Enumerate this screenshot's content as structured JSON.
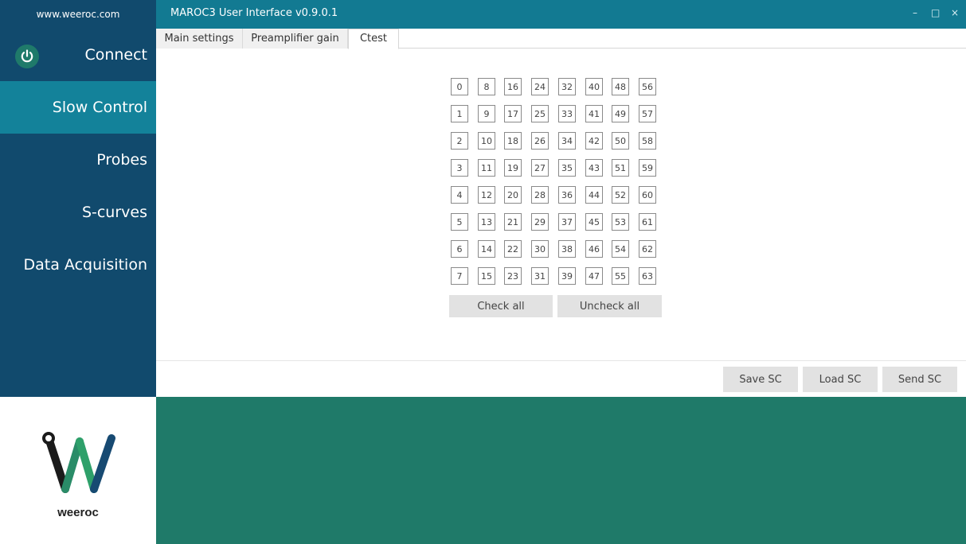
{
  "app": {
    "site": "www.weeroc.com",
    "title": "MAROC3 User Interface v0.9.0.1",
    "brand_name": "weeroc"
  },
  "window_controls": {
    "minimize": "–",
    "maximize": "□",
    "close": "×"
  },
  "nav": {
    "items": [
      {
        "label": "Connect"
      },
      {
        "label": "Slow Control",
        "active": true
      },
      {
        "label": "Probes"
      },
      {
        "label": "S-curves"
      },
      {
        "label": "Data Acquisition"
      }
    ]
  },
  "tabs": [
    {
      "label": "Main settings"
    },
    {
      "label": "Preamplifier gain"
    },
    {
      "label": "Ctest",
      "active": true
    }
  ],
  "ctest": {
    "channels": [
      [
        "0",
        "8",
        "16",
        "24",
        "32",
        "40",
        "48",
        "56"
      ],
      [
        "1",
        "9",
        "17",
        "25",
        "33",
        "41",
        "49",
        "57"
      ],
      [
        "2",
        "10",
        "18",
        "26",
        "34",
        "42",
        "50",
        "58"
      ],
      [
        "3",
        "11",
        "19",
        "27",
        "35",
        "43",
        "51",
        "59"
      ],
      [
        "4",
        "12",
        "20",
        "28",
        "36",
        "44",
        "52",
        "60"
      ],
      [
        "5",
        "13",
        "21",
        "29",
        "37",
        "45",
        "53",
        "61"
      ],
      [
        "6",
        "14",
        "22",
        "30",
        "38",
        "46",
        "54",
        "62"
      ],
      [
        "7",
        "15",
        "23",
        "31",
        "39",
        "47",
        "55",
        "63"
      ]
    ],
    "check_all": "Check all",
    "uncheck_all": "Uncheck all"
  },
  "actions": {
    "save_sc": "Save SC",
    "load_sc": "Load SC",
    "send_sc": "Send SC"
  },
  "colors": {
    "sidebar_bg": "#114a6d",
    "sidebar_active": "#13829a",
    "titlebar_bg": "#127a92",
    "bottom_panel_bg": "#1f7a69",
    "power_button": "#1f7a6a"
  },
  "icons": {
    "power": "power-icon",
    "logo": "weeroc-w-logo"
  }
}
